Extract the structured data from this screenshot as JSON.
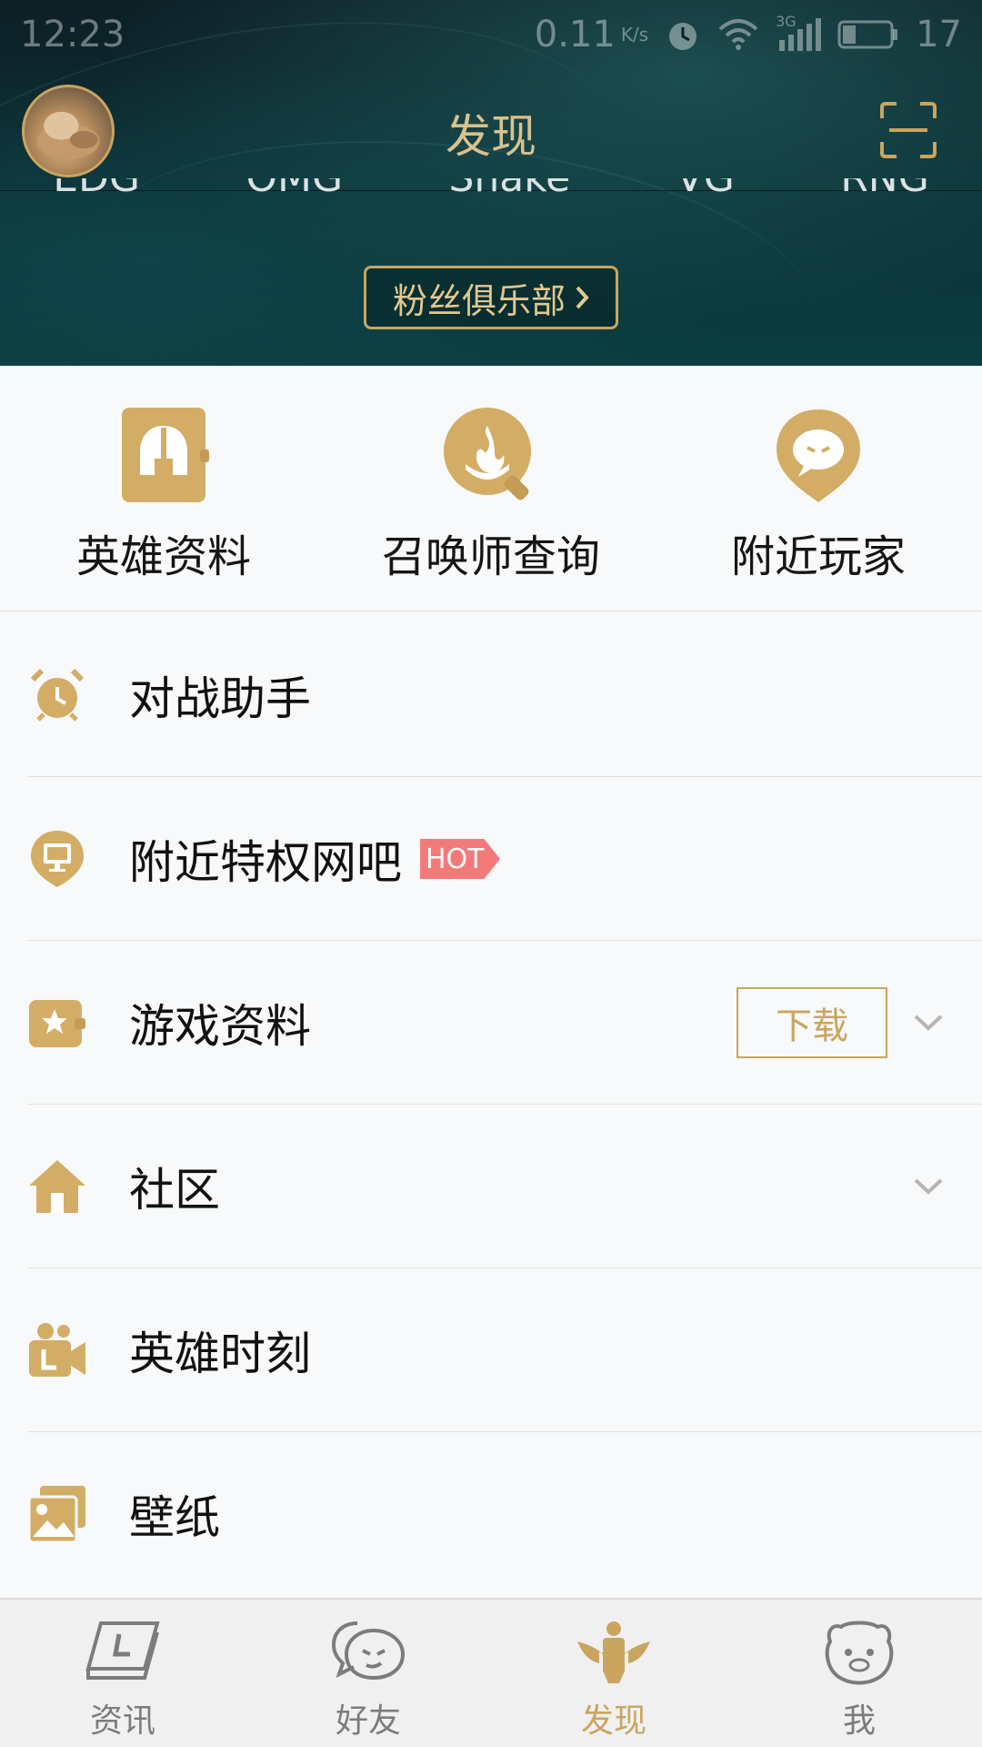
{
  "status_bar": {
    "time": "12:23",
    "net_speed": "0.11",
    "net_unit": "K/s",
    "network_type": "3G",
    "battery": "17"
  },
  "header": {
    "title": "发现",
    "scrolled_names": [
      "EDG",
      "OMG",
      "Shake",
      "VG",
      "RNG"
    ],
    "fan_club_label": "粉丝俱乐部"
  },
  "quick_actions": [
    {
      "label": "英雄资料",
      "icon": "helmet-icon"
    },
    {
      "label": "召唤师查询",
      "icon": "summoner-search-icon"
    },
    {
      "label": "附近玩家",
      "icon": "nearby-players-icon"
    }
  ],
  "menu": {
    "battle_assistant": "对战助手",
    "internet_cafe": "附近特权网吧",
    "hot_badge": "HOT",
    "game_data": "游戏资料",
    "download_label": "下载",
    "community": "社区",
    "hero_moments": "英雄时刻",
    "wallpaper": "壁纸"
  },
  "tabs": [
    {
      "label": "资讯",
      "active": false
    },
    {
      "label": "好友",
      "active": false
    },
    {
      "label": "发现",
      "active": true
    },
    {
      "label": "我",
      "active": false
    }
  ],
  "colors": {
    "accent_gold": "#c9a55f",
    "header_dark": "#0b2e33",
    "hot_red": "#f47a7a",
    "tab_inactive": "#7c7c7c"
  }
}
